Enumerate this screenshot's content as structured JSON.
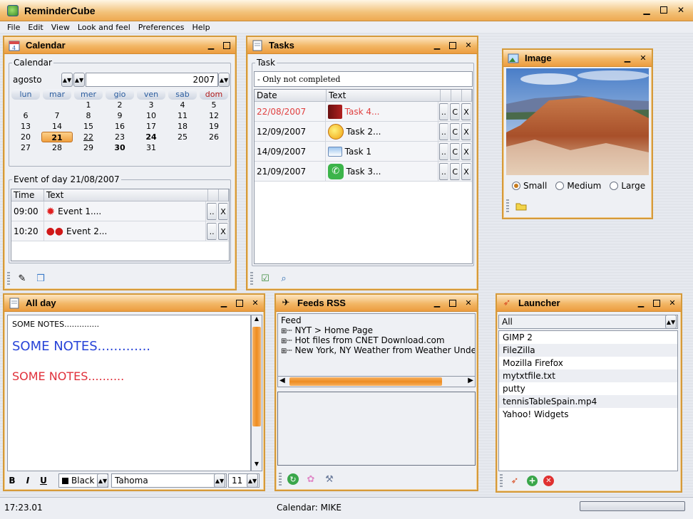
{
  "app": {
    "title": "ReminderCube"
  },
  "menu": {
    "file": "File",
    "edit": "Edit",
    "view": "View",
    "look": "Look and feel",
    "prefs": "Preferences",
    "help": "Help"
  },
  "calendar": {
    "title": "Calendar",
    "group": "Calendar",
    "month": "agosto",
    "year": "2007",
    "days": [
      "lun",
      "mar",
      "mer",
      "gio",
      "ven",
      "sab",
      "dom"
    ],
    "weeks": [
      [
        "",
        "",
        "1",
        "2",
        "3",
        "4",
        "5"
      ],
      [
        "6",
        "7",
        "8",
        "9",
        "10",
        "11",
        "12"
      ],
      [
        "13",
        "14",
        "15",
        "16",
        "17",
        "18",
        "19"
      ],
      [
        "20",
        "21",
        "22",
        "23",
        "24",
        "25",
        "26"
      ],
      [
        "27",
        "28",
        "29",
        "30",
        "31",
        "",
        ""
      ]
    ],
    "event_group": "Event of day 21/08/2007",
    "col_time": "Time",
    "col_text": "Text",
    "events": [
      {
        "time": "09:00",
        "text": "Event 1...."
      },
      {
        "time": "10:20",
        "text": "Event 2..."
      }
    ]
  },
  "tasks": {
    "title": "Tasks",
    "group": "Task",
    "filter": "- Only not completed",
    "col_date": "Date",
    "col_text": "Text",
    "rows": [
      {
        "date": "22/08/2007",
        "text": "Task 4...",
        "overdue": true
      },
      {
        "date": "12/09/2007",
        "text": "Task 2..."
      },
      {
        "date": "14/09/2007",
        "text": "Task 1"
      },
      {
        "date": "21/09/2007",
        "text": "Task 3..."
      }
    ],
    "btn_dots": "..",
    "btn_c": "C",
    "btn_x": "X"
  },
  "image": {
    "title": "Image",
    "options": [
      "Small",
      "Medium",
      "Large"
    ],
    "selected": "Small"
  },
  "allday": {
    "title": "All day",
    "line1": "SOME NOTES..............",
    "line2": "SOME NOTES.............",
    "line3": "SOME NOTES..........",
    "color": "Black",
    "font": "Tahoma",
    "size": "11",
    "bold": "B",
    "italic": "I",
    "underline": "U"
  },
  "feeds": {
    "title": "Feeds RSS",
    "group": "Feed",
    "items": [
      "NYT > Home Page",
      "Hot files from CNET Download.com",
      "New York, NY Weather from Weather Under"
    ]
  },
  "launcher": {
    "title": "Launcher",
    "filter": "All",
    "items": [
      "GIMP 2",
      "FileZilla",
      "Mozilla Firefox",
      "mytxtfile.txt",
      "putty",
      "tennisTableSpain.mp4",
      "Yahoo! Widgets"
    ]
  },
  "status": {
    "time": "17:23.01",
    "calendar": "Calendar: MIKE"
  },
  "colors": {
    "accent": "#ec9c3f",
    "overdue": "#e04040",
    "notes_blue": "#2844d8",
    "notes_red": "#e0303a"
  }
}
